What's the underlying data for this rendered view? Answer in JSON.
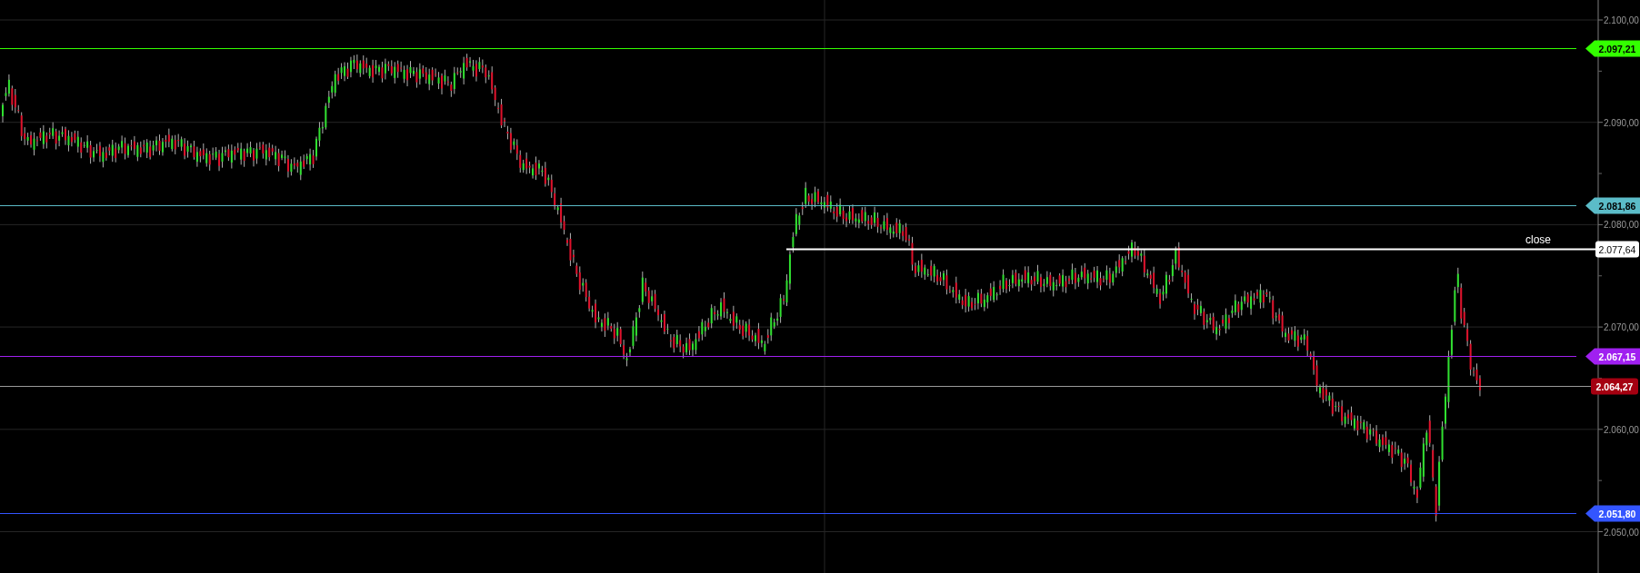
{
  "axis": {
    "ticks": [
      "2.100,00",
      "2.090,00",
      "2.080,00",
      "2.070,00",
      "2.060,00",
      "2.050,00"
    ]
  },
  "levels": [
    {
      "kind": "marker",
      "label": "2.097,21",
      "color": "#33ff00"
    },
    {
      "kind": "marker",
      "label": "2.081,86",
      "color": "#5bbcc8"
    },
    {
      "kind": "close",
      "label": "2.077,64",
      "caption": "close"
    },
    {
      "kind": "marker",
      "label": "2.067,15",
      "color": "#a020f0"
    },
    {
      "kind": "last",
      "label": "2.064,27",
      "color": "#a50011"
    },
    {
      "kind": "marker",
      "label": "2.051,80",
      "color": "#3355ff"
    }
  ]
}
